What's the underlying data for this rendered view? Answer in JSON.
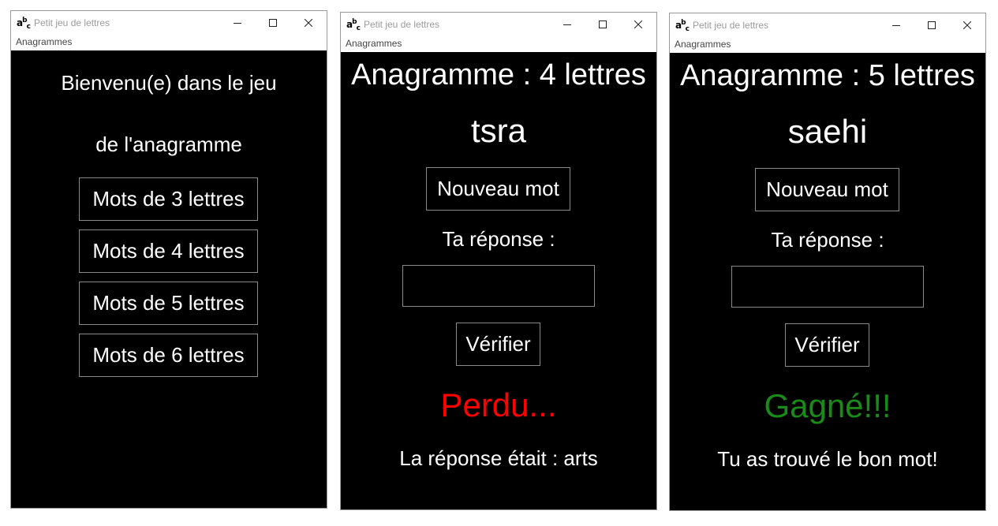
{
  "colors": {
    "lost": "#ff0000",
    "won": "#1a8a1a",
    "content_bg": "#000000",
    "text": "#ffffff"
  },
  "windows": [
    {
      "title": "Petit jeu de lettres",
      "menu": "Anagrammes",
      "welcome_line1": "Bienvenu(e) dans le jeu",
      "welcome_line2": "de l'anagramme",
      "buttons": [
        "Mots de 3 lettres",
        "Mots de 4 lettres",
        "Mots de 5 lettres",
        "Mots de 6 lettres"
      ]
    },
    {
      "title": "Petit jeu de lettres",
      "menu": "Anagrammes",
      "heading": "Anagramme : 4 lettres",
      "word": "tsra",
      "new_word_button": "Nouveau mot",
      "answer_label": "Ta réponse :",
      "answer_value": "",
      "check_button": "Vérifier",
      "result": "Perdu...",
      "message": "La réponse était : arts"
    },
    {
      "title": "Petit jeu de lettres",
      "menu": "Anagrammes",
      "heading": "Anagramme : 5 lettres",
      "word": "saehi",
      "new_word_button": "Nouveau mot",
      "answer_label": "Ta réponse :",
      "answer_value": "",
      "check_button": "Vérifier",
      "result": "Gagné!!!",
      "message": "Tu as trouvé le bon mot!"
    }
  ]
}
